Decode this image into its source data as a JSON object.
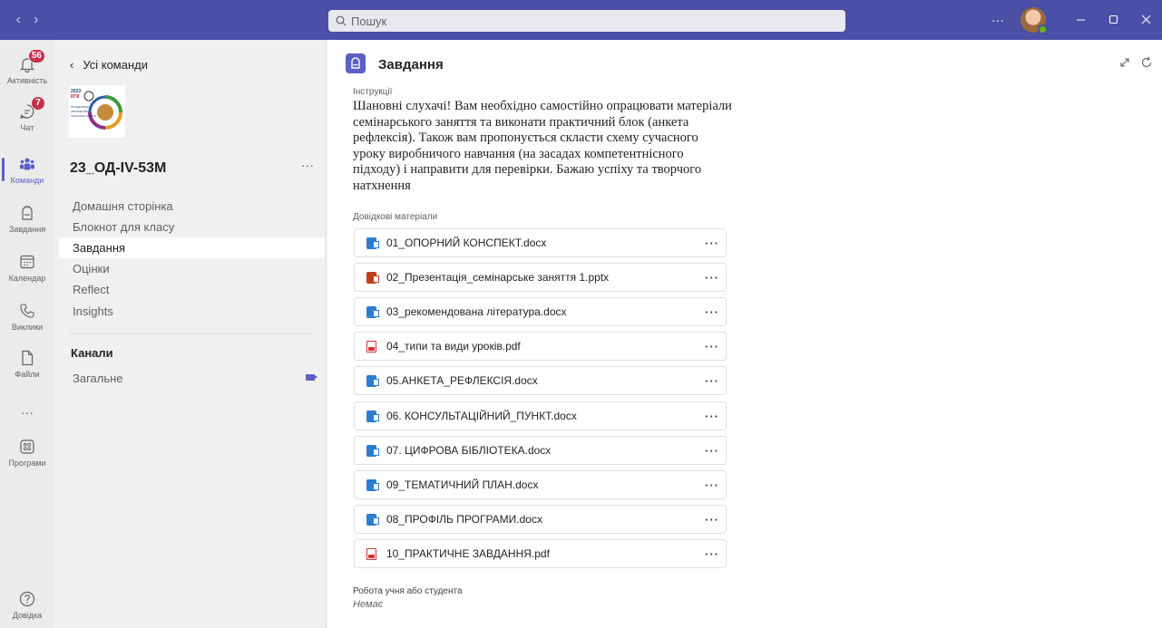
{
  "titlebar": {
    "search_placeholder": "Пошук",
    "more": "···",
    "back_arrow": "‹",
    "forward_arrow": "›"
  },
  "rail": {
    "items": [
      {
        "label": "Активність",
        "icon": "bell-icon",
        "badge": "56"
      },
      {
        "label": "Чат",
        "icon": "chat-icon",
        "badge": "7"
      },
      {
        "label": "Команди",
        "icon": "teams-icon",
        "active": true
      },
      {
        "label": "Завдання",
        "icon": "backpack-icon"
      },
      {
        "label": "Календар",
        "icon": "calendar-icon"
      },
      {
        "label": "Виклики",
        "icon": "phone-icon"
      },
      {
        "label": "Файли",
        "icon": "file-icon"
      },
      {
        "label": "···",
        "icon": "more-icon"
      },
      {
        "label": "Програми",
        "icon": "apps-icon"
      }
    ],
    "help_label": "Довідка"
  },
  "panel": {
    "back_label": "Усі команди",
    "team_name": "23_ОД-IV-53М",
    "team_more": "···",
    "logo_text": [
      "2023",
      "КПК",
      "ПРОФЕСІЙНА",
      "(ПРОФЕСІЙНО-",
      "ТЕХНІЧНА) ОСВІТА"
    ],
    "nav": [
      "Домашня сторінка",
      "Блокнот для класу",
      "Завдання",
      "Оцінки",
      "Reflect",
      "Insights"
    ],
    "active_nav": "Завдання",
    "channels_title": "Канали",
    "channel": "Загальне"
  },
  "main": {
    "title": "Завдання",
    "instructions_label": "Інструкції",
    "instructions_text": "Шановні слухачі! Вам необхідно самостійно опрацювати матеріали семінарського заняття та виконати практичний блок (анкета рефлексія). Також вам  пропонується скласти схему сучасного уроку виробничого навчання (на засадах компетентнісного підходу) і направити для перевірки. Бажаю успіху та творчого натхнення",
    "reference_label": "Довідкові матеріали",
    "attachments": [
      {
        "name": "01_ОПОРНИЙ КОНСПЕКТ.docx",
        "type": "word"
      },
      {
        "name": "02_Презентація_семінарське заняття 1.pptx",
        "type": "ppt"
      },
      {
        "name": "03_рекомендована література.docx",
        "type": "word"
      },
      {
        "name": "04_типи та види уроків.pdf",
        "type": "pdf"
      },
      {
        "name": "05.АНКЕТА_РЕФЛЕКСІЯ.docx",
        "type": "word"
      },
      {
        "name": "06. КОНСУЛЬТАЦІЙНИЙ_ПУНКТ.docx",
        "type": "word"
      },
      {
        "name": "07. ЦИФРОВА БІБЛІОТЕКА.docx",
        "type": "word"
      },
      {
        "name": "09_ТЕМАТИЧНИЙ ПЛАН.docx",
        "type": "word"
      },
      {
        "name": "08_ПРОФІЛЬ ПРОГРАМИ.docx",
        "type": "word"
      },
      {
        "name": "10_ПРАКТИЧНЕ ЗАВДАННЯ.pdf",
        "type": "pdf"
      }
    ],
    "attachment_more": "···",
    "work_label": "Робота учня або студента",
    "work_value": "Немає"
  },
  "colors": {
    "titlebar": "#4b4fa5",
    "accent": "#5b5fc7",
    "badge": "#c4314b",
    "word": "#2b7cd3",
    "ppt": "#c43e1c",
    "pdf": "#d13438",
    "presence": "#6bb700"
  }
}
